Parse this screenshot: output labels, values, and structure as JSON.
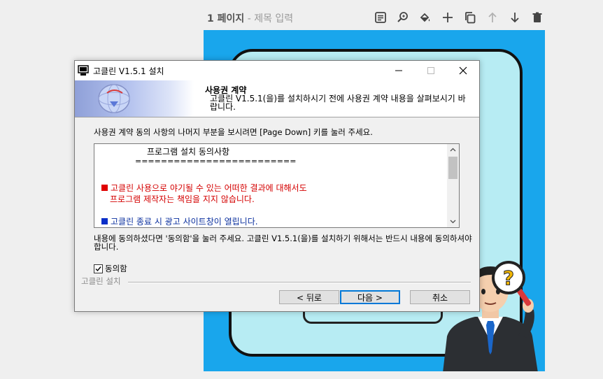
{
  "page": {
    "number": "1 페이지",
    "separator": " - ",
    "title_placeholder": "제목 입력"
  },
  "toolbar": {
    "buttons": [
      {
        "icon": "memo-icon"
      },
      {
        "icon": "magic-search-icon"
      },
      {
        "icon": "paint-bucket-icon"
      },
      {
        "icon": "plus-icon"
      },
      {
        "icon": "duplicate-icon"
      },
      {
        "icon": "arrow-up-icon",
        "disabled": true
      },
      {
        "icon": "arrow-down-icon"
      },
      {
        "icon": "trash-icon"
      }
    ]
  },
  "dialog": {
    "title": "고클린 V1.5.1 설치",
    "header": {
      "heading": "사용권 계약",
      "description": "고클린 V1.5.1(을)를 설치하시기 전에 사용권 계약 내용을 살펴보시기 바랍니다."
    },
    "instruction": "사용권 계약 동의 사항의 나머지 부분을 보시려면 [Page Down] 키를 눌러 주세요.",
    "license": {
      "title": "프로그램 설치 동의사항",
      "rule": "=========================",
      "red_line1": "고클린 사용으로 야기될 수 있는 어떠한 결과에 대해서도",
      "red_line2": "프로그램 제작자는 책임을 지지 않습니다.",
      "blue_line": "고클린 종료 시 광고 사이트창이 열립니다."
    },
    "agree_note": "내용에 동의하셨다면 '동의함'을 눌러 주세요. 고클린 V1.5.1(을)를 설치하기 위해서는 반드시 내용에 동의하셔야 합니다.",
    "checkbox": {
      "label": "동의함",
      "checked": true
    },
    "group_label": "고클린 설치",
    "buttons": {
      "back": "< 뒤로",
      "next": "다음 >",
      "cancel": "취소"
    }
  },
  "colors": {
    "canvas": "#19a6ec",
    "frame_fill": "#b7ecf3",
    "license_red": "#d40000",
    "license_blue": "#0a2f9e",
    "focus_blue": "#0078d7"
  }
}
